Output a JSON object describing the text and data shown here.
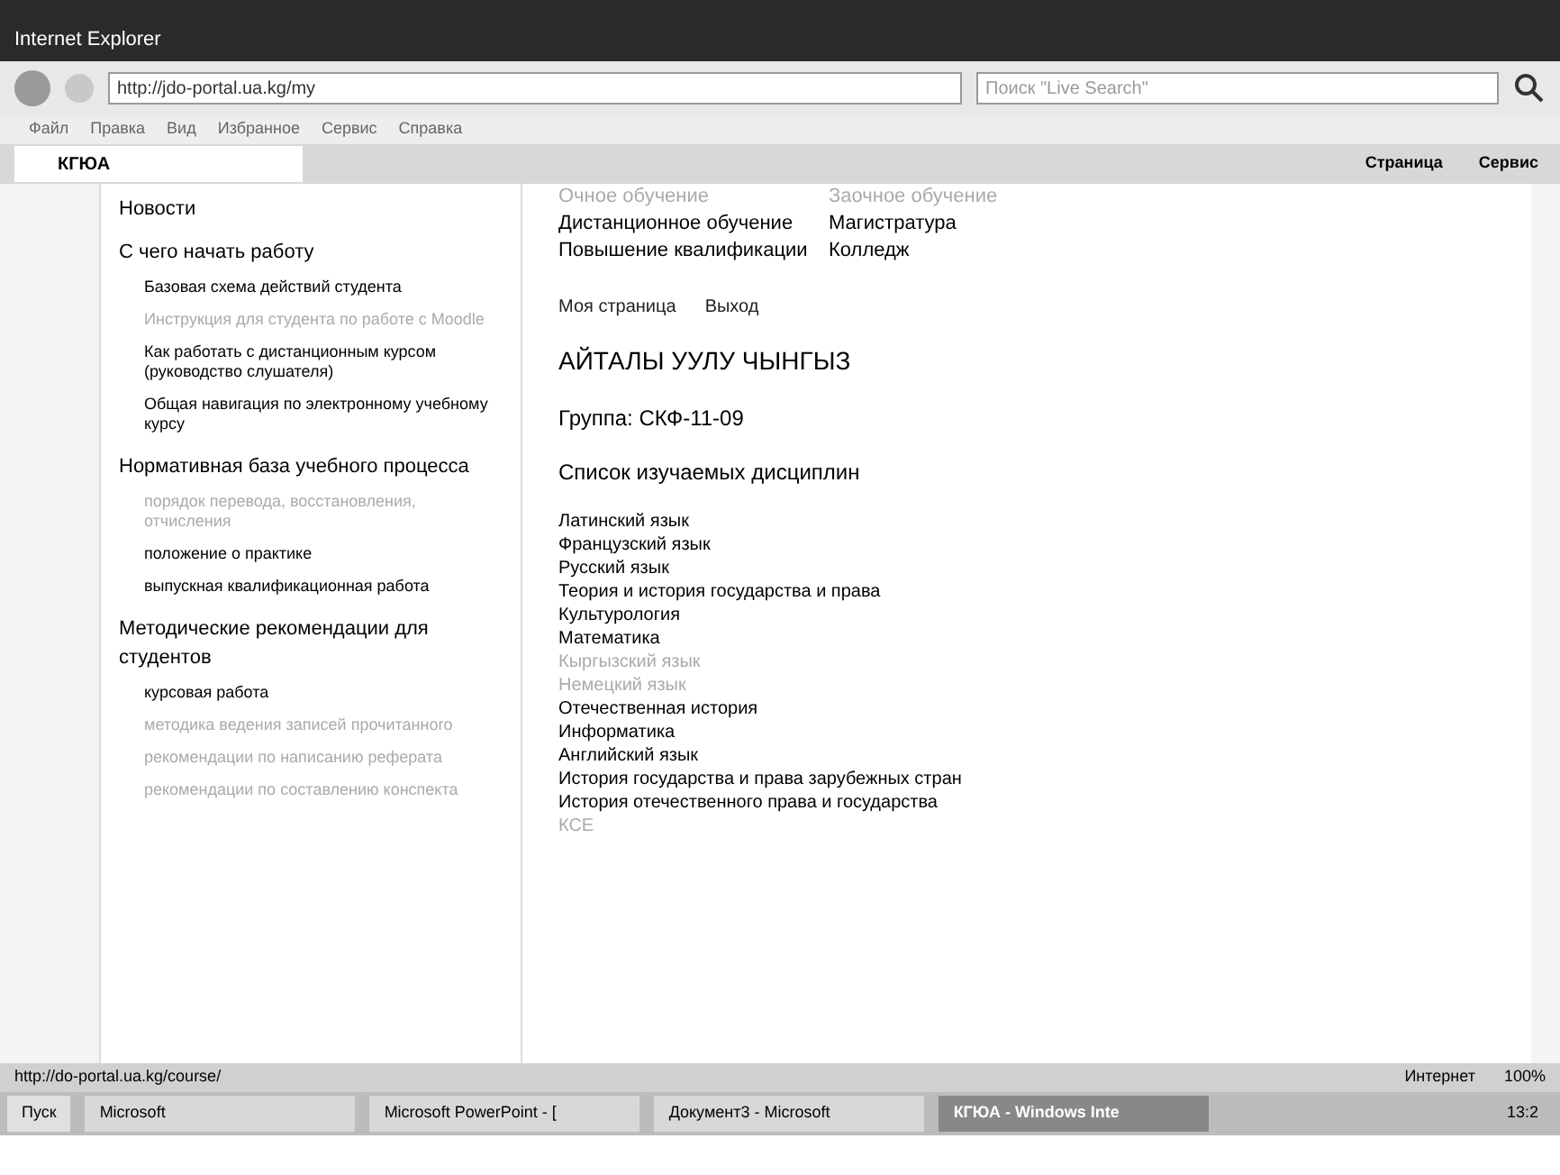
{
  "window": {
    "title": "Internet Explorer"
  },
  "address_bar": {
    "url": "http://jdo-portal.ua.kg/my",
    "search_placeholder": "Поиск \"Live Search\""
  },
  "menu": [
    "Файл",
    "Правка",
    "Вид",
    "Избранное",
    "Сервис",
    "Справка"
  ],
  "tab": {
    "title": "КГЮА"
  },
  "toolbar_buttons": [
    "Страница",
    "Сервис"
  ],
  "sidebar": [
    {
      "label": "Новости"
    },
    {
      "label": "С чего начать работу",
      "children": [
        {
          "label": "Базовая схема действий студента",
          "faded": false
        },
        {
          "label": "Инструкция для студента по работе с Moodle",
          "faded": true
        },
        {
          "label": "Как работать с дистанционным курсом (руководство слушателя)",
          "faded": false
        },
        {
          "label": "Общая навигация по электронному учебному курсу",
          "faded": false
        }
      ]
    },
    {
      "label": "Нормативная база учебного процесса",
      "children": [
        {
          "label": "порядок перевода, восстановления, отчисления",
          "faded": true
        },
        {
          "label": "положение о практике",
          "faded": false
        },
        {
          "label": "выпускная квалификационная работа",
          "faded": false
        }
      ]
    },
    {
      "label": "Методические рекомендации для студентов",
      "children": [
        {
          "label": "курсовая работа",
          "faded": false
        },
        {
          "label": "методика ведения записей прочитанного",
          "faded": true
        },
        {
          "label": "рекомендации по написанию реферата",
          "faded": true
        },
        {
          "label": "рекомендации по составлению конспекта",
          "faded": true
        }
      ]
    }
  ],
  "study_forms": [
    {
      "label": "Очное обучение",
      "faded": true
    },
    {
      "label": "Заочное обучение",
      "faded": true
    },
    {
      "label": "Дистанционное обучение",
      "faded": false
    },
    {
      "label": "Магистратура",
      "faded": false
    },
    {
      "label": "Повышение квалификации",
      "faded": false
    },
    {
      "label": "Колледж",
      "faded": false
    }
  ],
  "user_links": [
    "Моя страница",
    "Выход"
  ],
  "student_name": "АЙТАЛЫ УУЛУ ЧЫНГЫЗ",
  "group": "Группа: СКФ-11-09",
  "courses_heading": "Список изучаемых дисциплин",
  "courses": [
    {
      "label": "Латинский язык",
      "faded": false
    },
    {
      "label": "Французский язык",
      "faded": false
    },
    {
      "label": "Русский язык",
      "faded": false
    },
    {
      "label": "Теория и история государства и права",
      "faded": false
    },
    {
      "label": "Культурология",
      "faded": false
    },
    {
      "label": "Математика",
      "faded": false
    },
    {
      "label": "Кыргызский язык",
      "faded": true
    },
    {
      "label": "Немецкий язык",
      "faded": true
    },
    {
      "label": "Отечественная история",
      "faded": false
    },
    {
      "label": "Информатика",
      "faded": false
    },
    {
      "label": "Английский язык",
      "faded": false
    },
    {
      "label": "История государства и права зарубежных стран",
      "faded": false
    },
    {
      "label": "История отечественного права и государства",
      "faded": false
    },
    {
      "label": "КСЕ",
      "faded": true
    }
  ],
  "status_bar": {
    "url": "http://do-portal.ua.kg/course/",
    "zone": "Интернет",
    "zoom": "100%"
  },
  "taskbar": {
    "start": "Пуск",
    "items": [
      {
        "label": "Microsoft",
        "selected": false
      },
      {
        "label": "Microsoft PowerPoint - [",
        "selected": false
      },
      {
        "label": "Документ3 - Microsoft",
        "selected": false
      },
      {
        "label": "КГЮА - Windows Inte",
        "selected": true
      }
    ],
    "clock": "13:2"
  }
}
